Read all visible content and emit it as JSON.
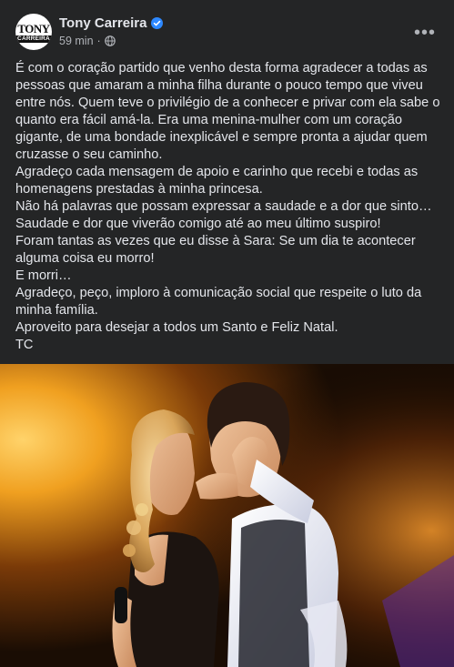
{
  "post": {
    "author": {
      "name": "Tony Carreira",
      "avatar_logo_top": "TONY",
      "avatar_logo_bottom": "CARREIRA",
      "verified_icon": "verified-badge-icon"
    },
    "timestamp": "59 min",
    "meta_separator": "·",
    "audience_icon": "globe-icon",
    "more_button_label": "•••",
    "paragraphs": [
      "É com o coração partido que venho desta forma agradecer a todas as pessoas que amaram a minha filha durante o pouco tempo que viveu entre nós. Quem teve o privilégio de a conhecer e privar com ela sabe o quanto era fácil amá-la. Era uma menina-mulher com um coração gigante, de uma bondade inexplicável e sempre pronta a ajudar quem cruzasse o seu caminho.",
      "Agradeço cada mensagem de apoio e carinho que recebi e todas as homenagens prestadas à minha princesa.",
      "Não há palavras que possam expressar a saudade e a dor que sinto…",
      "Saudade e dor que viverão comigo até ao meu último suspiro!",
      "Foram tantas as vezes que eu disse à Sara: Se um dia te acontecer alguma coisa eu morro!",
      "E morri…",
      "Agradeço, peço, imploro à comunicação social que respeite o luto da minha família.",
      "Aproveito para desejar a todos um Santo e Feliz Natal.",
      "TC"
    ]
  },
  "colors": {
    "card_background": "#242526",
    "primary_text": "#e4e6eb",
    "secondary_text": "#b0b3b8",
    "verified_blue": "#2d88ff",
    "photo_glow": "#f0a020"
  }
}
